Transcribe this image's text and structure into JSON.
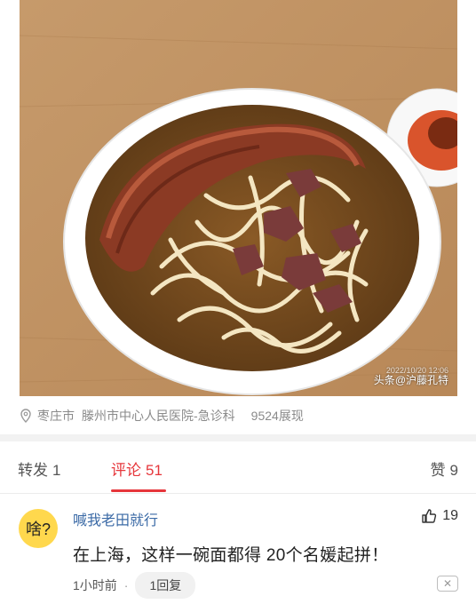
{
  "photo": {
    "watermark_brand": "头条",
    "watermark_author": "@沪藤孔特",
    "watermark_timestamp": "2022/10/20 12:06"
  },
  "location": {
    "city": "枣庄市",
    "place": "滕州市中心人民医院-急诊科",
    "views": "9524展现"
  },
  "tabs": {
    "repost_label": "转发",
    "repost_count": "1",
    "comment_label": "评论",
    "comment_count": "51",
    "like_label": "赞",
    "like_count": "9"
  },
  "comment": {
    "avatar_text": "啥?",
    "username": "喊我老田就行",
    "like_count": "19",
    "text": "在上海，这样一碗面都得 20个名媛起拼！",
    "time": "1小时前",
    "reply_label": "1回复"
  },
  "colors": {
    "accent": "#e6363b",
    "username": "#3b6aa6",
    "avatar_bg": "#ffd84d"
  }
}
